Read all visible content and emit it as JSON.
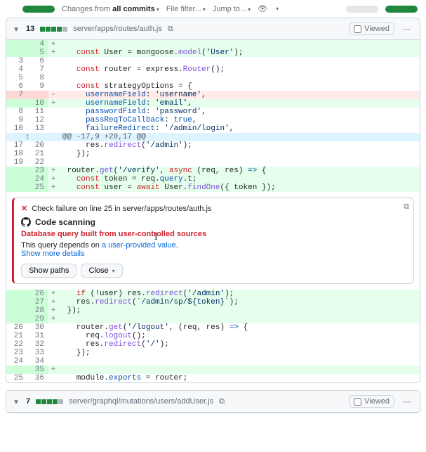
{
  "topbar": {
    "changes_from": "Changes from",
    "all_commits": "all commits",
    "file_filter": "File filter...",
    "jump_to": "Jump to..."
  },
  "file1": {
    "count": "13",
    "path": "server/apps/routes/auth.js",
    "hunk": "@@ -17,9 +20,17 @@",
    "l": {
      "a": "    ",
      "b": "+",
      "c": "+   const User = mongoose.model('User');",
      "d": "    const router = express.Router();",
      "e": "    const strategyOptions = {",
      "f": "-     usernameField: 'username',",
      "g": "+     usernameField: 'email',",
      "h": "      passwordField: 'password',",
      "i": "      passReqToCallback: true,",
      "j": "      failureRedirect: '/admin/login',",
      "k": "      res.redirect('/admin');",
      "l": "    });",
      "m": "",
      "n": "+ router.get('/verify', async (req, res) => {",
      "o": "+   const token = req.query.t;",
      "p": "+   const user = await User.findOne({ token });",
      "q": "+   if (!user) res.redirect('/admin');",
      "r": "+   res.redirect(`/admin/sp/${token}`);",
      "s": "+ });",
      "t": "+",
      "u": "    router.get('/logout', (req, res) => {",
      "v": "      req.logout();",
      "w": "      res.redirect('/');",
      "x": "    });",
      "y": "",
      "z": "+",
      "aa": "    module.exports = router;"
    },
    "ln": {
      "r1l": "",
      "r1r": "4",
      "r2l": "",
      "r2r": "5",
      "r3l": "3",
      "r3r": "6",
      "r4l": "4",
      "r4r": "7",
      "r5l": "5",
      "r5r": "8",
      "r6l": "6",
      "r6r": "9",
      "r7l": "7",
      "r7r": "",
      "r8l": "",
      "r8r": "10",
      "r9l": "8",
      "r9r": "11",
      "r10l": "9",
      "r10r": "12",
      "r11l": "10",
      "r11r": "13",
      "r12l": "17",
      "r12r": "20",
      "r13l": "18",
      "r13r": "21",
      "r14l": "19",
      "r14r": "22",
      "r15l": "",
      "r15r": "23",
      "r16l": "",
      "r16r": "24",
      "r17l": "",
      "r17r": "25",
      "r18l": "",
      "r18r": "26",
      "r19l": "",
      "r19r": "27",
      "r20l": "",
      "r20r": "28",
      "r21l": "",
      "r21r": "29",
      "r22l": "20",
      "r22r": "30",
      "r23l": "21",
      "r23r": "31",
      "r24l": "22",
      "r24r": "32",
      "r25l": "23",
      "r25r": "33",
      "r26l": "24",
      "r26r": "34",
      "r27l": "",
      "r27r": "35",
      "r28l": "25",
      "r28r": "36"
    }
  },
  "alert": {
    "check_fail": "Check failure on line 25 in server/apps/routes/auth.js",
    "title": "Code scanning",
    "message": "Database query built from user-controlled sources",
    "body_prefix": "This query depends on ",
    "body_link": "a user-provided value",
    "body_suffix": ".",
    "more": "Show more details",
    "show_paths": "Show paths",
    "close": "Close"
  },
  "file2": {
    "count": "7",
    "path": "server/graphql/mutations/users/addUser.js"
  },
  "ui": {
    "viewed": "Viewed",
    "expand_icon": "↕"
  }
}
